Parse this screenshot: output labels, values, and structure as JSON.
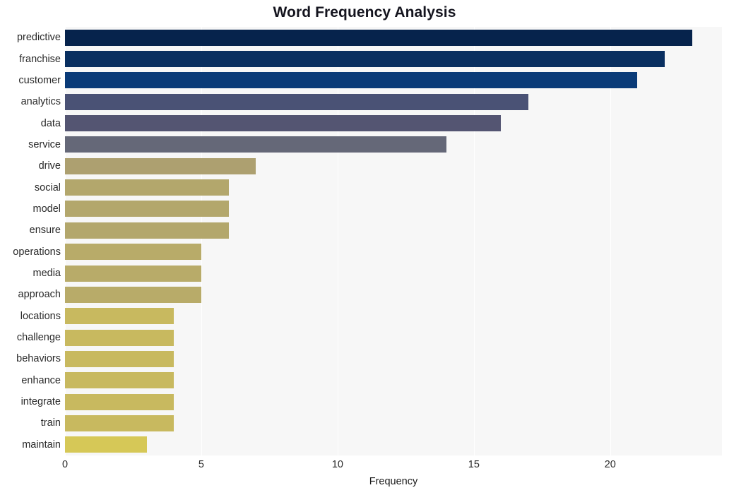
{
  "chart_data": {
    "type": "bar",
    "orientation": "horizontal",
    "title": "Word Frequency Analysis",
    "xlabel": "Frequency",
    "ylabel": "",
    "categories": [
      "predictive",
      "franchise",
      "customer",
      "analytics",
      "data",
      "service",
      "drive",
      "social",
      "model",
      "ensure",
      "operations",
      "media",
      "approach",
      "locations",
      "challenge",
      "behaviors",
      "enhance",
      "integrate",
      "train",
      "maintain"
    ],
    "values": [
      23,
      22,
      21,
      17,
      16,
      14,
      7,
      6,
      6,
      6,
      5,
      5,
      5,
      4,
      4,
      4,
      4,
      4,
      4,
      3
    ],
    "bar_colors": [
      "#06234c",
      "#092f60",
      "#0a3b78",
      "#4a5275",
      "#545572",
      "#656878",
      "#ada070",
      "#b3a76c",
      "#b3a76c",
      "#b3a76c",
      "#b8ab69",
      "#b8ab69",
      "#b8ab69",
      "#c8b95f",
      "#c8b95f",
      "#c8b95f",
      "#c8b95f",
      "#c8b95f",
      "#c8b95f",
      "#d6c857"
    ],
    "xlim": [
      0,
      24.1
    ],
    "xticks": [
      0,
      5,
      10,
      15,
      20
    ],
    "xtick_labels": [
      "0",
      "5",
      "10",
      "15",
      "20"
    ],
    "grid": true,
    "grid_axis": "x",
    "legend": "none",
    "plot_background": "#f7f7f7",
    "figure_background": "#ffffff",
    "gridline_color": "#ffffff"
  }
}
